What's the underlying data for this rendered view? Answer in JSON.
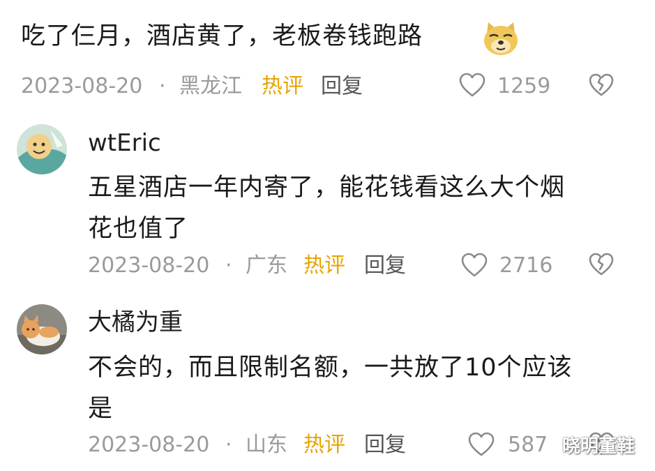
{
  "comment1": {
    "text": "吃了仨月，酒店黄了，老板卷钱跑路",
    "emoji_icon": "doge-emoji-icon",
    "date": "2023-08-20",
    "separator": "·",
    "region": "黑龙江",
    "hot_label": "热评",
    "reply_label": "回复",
    "likes": "1259"
  },
  "replies": [
    {
      "username": "wtEric",
      "text_line1": "五星酒店一年内寄了，能花钱看这么大个烟",
      "text_line2": "花也值了",
      "date": "2023-08-20",
      "separator": "·",
      "region": "广东",
      "hot_label": "热评",
      "reply_label": "回复",
      "likes": "2716"
    },
    {
      "username": "大橘为重",
      "text_line1": "不会的，而且限制名额，一共放了10个应该",
      "text_line2": "是",
      "date": "2023-08-20",
      "separator": "·",
      "region": "山东",
      "hot_label": "热评",
      "reply_label": "回复",
      "likes": "587"
    }
  ],
  "watermark": "晓明董鞋",
  "colors": {
    "text": "#1a1a1a",
    "meta": "#9a9a9a",
    "hot": "#e7a400",
    "icon": "#8a8a8a"
  }
}
